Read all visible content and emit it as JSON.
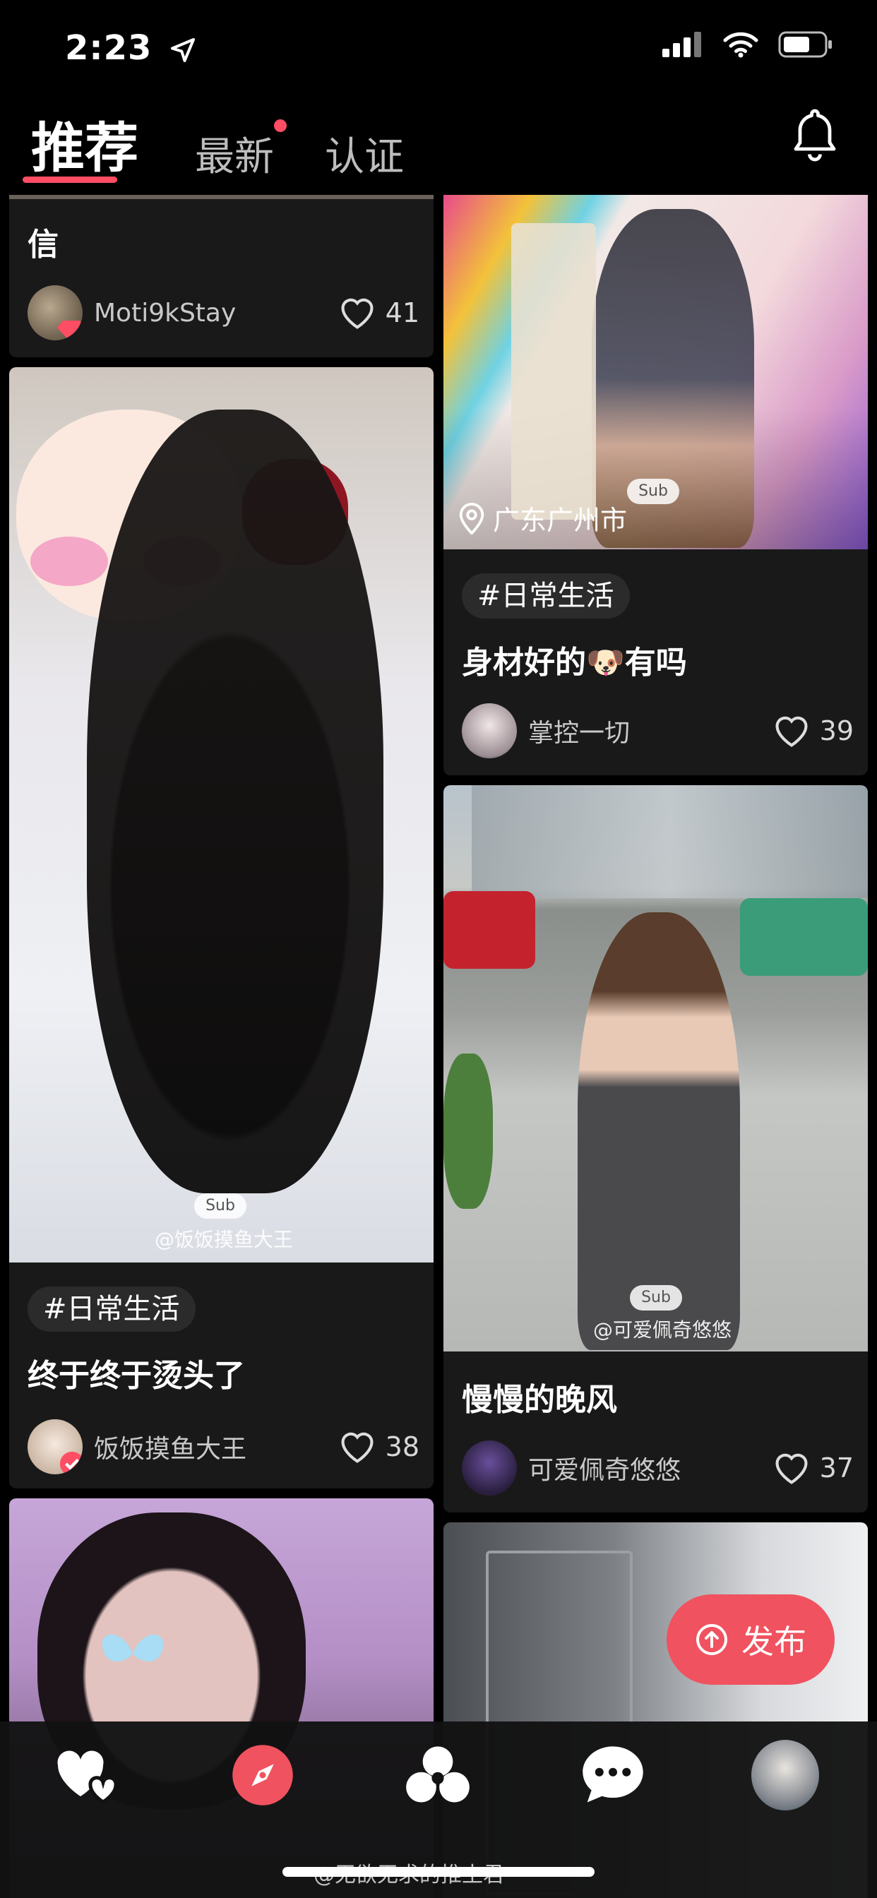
{
  "status_bar": {
    "time": "2:23"
  },
  "header": {
    "tabs": [
      {
        "label": "推荐"
      },
      {
        "label": "最新"
      },
      {
        "label": "认证"
      }
    ]
  },
  "feed": {
    "card1": {
      "title": "信",
      "author": "Moti9kStay",
      "likes": "41"
    },
    "card2": {
      "location": "广东广州市",
      "sub_badge": "Sub",
      "tag": "#日常生活",
      "title": "身材好的🐶有吗",
      "author": "掌控一切",
      "likes": "39"
    },
    "card3": {
      "sub_badge": "Sub",
      "watermark": "@饭饭摸鱼大王",
      "tag": "#日常生活",
      "title": "终于终于烫头了",
      "author": "饭饭摸鱼大王",
      "likes": "38"
    },
    "card4": {
      "sub_badge": "Sub",
      "watermark": "@可爱佩奇悠悠",
      "title": "慢慢的晚风",
      "author": "可爱佩奇悠悠",
      "likes": "37"
    }
  },
  "publish_button": {
    "label": "发布"
  },
  "bottom_nav": {
    "items": [
      {
        "icon": "hearts-icon"
      },
      {
        "icon": "compass-icon"
      },
      {
        "icon": "clover-icon"
      },
      {
        "icon": "chat-bubble-icon"
      },
      {
        "icon": "profile-avatar"
      }
    ]
  },
  "watermark_bottom": "@无欲无求的推土君",
  "colors": {
    "accent": "#ff4d63",
    "publish": "#f0525f",
    "card_bg": "#191919"
  }
}
